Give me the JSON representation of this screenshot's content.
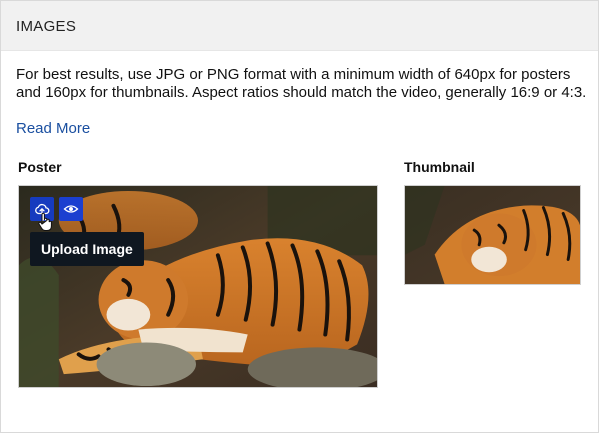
{
  "section": {
    "title": "IMAGES",
    "description": "For best results, use JPG or PNG format with a minimum width of 640px for posters and 160px for thumbnails. Aspect ratios should match the video, generally 16:9 or 4:3.",
    "read_more": "Read More"
  },
  "poster": {
    "label": "Poster",
    "tooltip": "Upload Image",
    "upload_icon": "cloud-upload-icon",
    "view_icon": "eye-icon"
  },
  "thumbnail": {
    "label": "Thumbnail"
  },
  "colors": {
    "accent": "#1b3fd0",
    "link": "#1a4fa0",
    "tooltip_bg": "#0f1720",
    "header_bg": "#f1f1f1"
  }
}
